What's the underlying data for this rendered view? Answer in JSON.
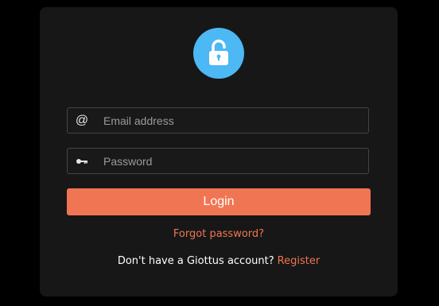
{
  "header": {
    "icon": "lock-icon",
    "icon_color": "#4cb8f4"
  },
  "form": {
    "email": {
      "icon": "at-icon",
      "icon_glyph": "@",
      "placeholder": "Email address",
      "value": ""
    },
    "password": {
      "icon": "key-icon",
      "placeholder": "Password",
      "value": ""
    },
    "login_label": "Login",
    "login_color": "#f07552"
  },
  "links": {
    "forgot_password": "Forgot password?",
    "register_prompt": "Don't have a Giottus account?",
    "register_label": "Register",
    "link_color": "#f07552"
  },
  "colors": {
    "page_background": "#000000",
    "card_background": "#171717"
  }
}
